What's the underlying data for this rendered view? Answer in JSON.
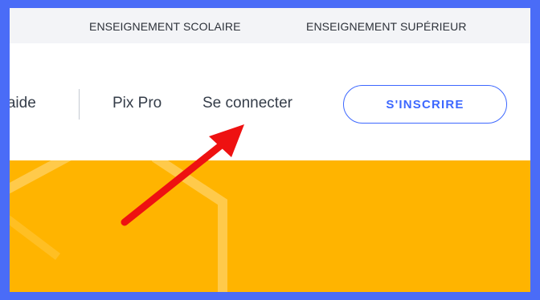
{
  "topbar": {
    "school": "ENSEIGNEMENT SCOLAIRE",
    "higher": "ENSEIGNEMENT SUPÉRIEUR"
  },
  "nav": {
    "help": "l'aide",
    "pix_pro": "Pix Pro",
    "login": "Se connecter",
    "signup": "S'INSCRIRE"
  },
  "colors": {
    "frame": "#4a6cf7",
    "accent": "#3d68ff",
    "hero": "#ffb400",
    "annotation_arrow": "#ee1111"
  },
  "icons": {
    "annotation": "red-arrow-icon"
  }
}
